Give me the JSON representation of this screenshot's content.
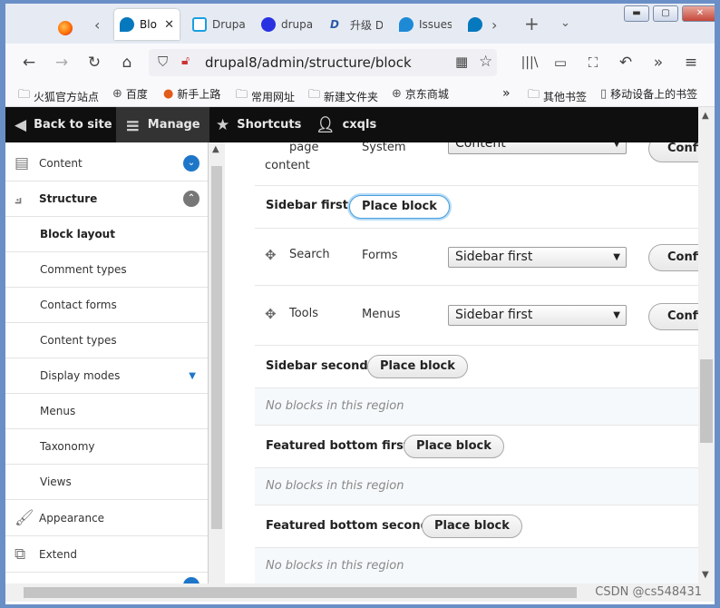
{
  "browser": {
    "tabs": [
      {
        "label": "Blo",
        "active": true,
        "icon": "drupal-icon"
      },
      {
        "label": "Drupa",
        "icon": "calendar-icon"
      },
      {
        "label": "drupa",
        "icon": "baidu-paw-icon"
      },
      {
        "label": "升级 D",
        "icon": "d-logo-icon"
      },
      {
        "label": "Issues",
        "icon": "drop-icon"
      }
    ],
    "url": "drupal8/admin/structure/block",
    "bookmarks": [
      "火狐官方站点",
      "百度",
      "新手上路",
      "常用网址",
      "新建文件夹",
      "京东商城"
    ],
    "bookmarks_right": [
      "其他书签",
      "移动设备上的书签"
    ]
  },
  "toolbar": {
    "back": "Back to site",
    "manage": "Manage",
    "shortcuts": "Shortcuts",
    "user": "cxqls"
  },
  "sidebar": {
    "content": "Content",
    "structure": "Structure",
    "children": [
      "Block layout",
      "Comment types",
      "Contact forms",
      "Content types",
      "Display modes",
      "Menus",
      "Taxonomy",
      "Views"
    ],
    "appearance": "Appearance",
    "extend": "Extend"
  },
  "main": {
    "top_row": {
      "name_line1": "page",
      "name_line2": "content",
      "category": "System",
      "region": "Content",
      "button": "Confi"
    },
    "sidebar_first": {
      "label": "Sidebar first",
      "button": "Place block"
    },
    "blocks": [
      {
        "name": "Search",
        "category": "Forms",
        "region": "Sidebar first",
        "button": "Confi"
      },
      {
        "name": "Tools",
        "category": "Menus",
        "region": "Sidebar first",
        "button": "Confi"
      }
    ],
    "sidebar_second": {
      "label": "Sidebar second",
      "button": "Place block"
    },
    "empty_text": "No blocks in this region",
    "featured_first": {
      "label": "Featured bottom first",
      "button": "Place block"
    },
    "featured_second": {
      "label": "Featured bottom second",
      "button": "Place block"
    }
  },
  "watermark": "CSDN @cs548431"
}
